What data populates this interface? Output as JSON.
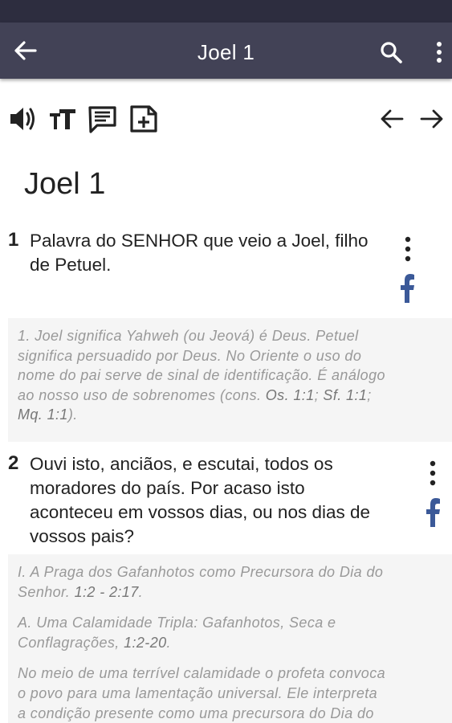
{
  "appbar": {
    "title": "Joel 1"
  },
  "chapter": {
    "title": "Joel 1"
  },
  "verses": [
    {
      "number": "1",
      "lines": [
        "Palavra do SENHOR que veio a Joel, filho",
        "de Petuel."
      ]
    },
    {
      "number": "2",
      "lines": [
        "Ouvi isto, anciãos, e escutai, todos os",
        "moradores do país. Por acaso isto",
        "aconteceu em vossos dias, ou nos dias de",
        "vossos pais?"
      ]
    }
  ],
  "notes": {
    "n1": {
      "lines": [
        "1. Joel significa Yahweh (ou Jeová) é Deus. Petuel",
        "significa persuadido por Deus. No Oriente o uso do",
        "nome do pai serve de sinal de identificação. É análogo",
        "ao nosso uso de sobrenomes (cons. "
      ],
      "ref_os": "Os. 1:1",
      "sep1": "; ",
      "ref_sf": "Sf. 1:1",
      "sep2": ";",
      "ref_mq": "Mq. 1:1",
      "end": ")."
    },
    "n2": {
      "heading1_line1": "I. A Praga dos Gafanhotos como Precursora do Dia do",
      "heading1_line2": "Senhor. ",
      "heading1_ref": "1:2 - 2:17",
      "heading1_end": ".",
      "heading2_line1": "A. Uma Calamidade Tripla: Gafanhotos, Seca e",
      "heading2_line2": "Conflagrações, ",
      "heading2_ref": "1:2-20",
      "heading2_end": ".",
      "body_lines": [
        "No meio de uma terrível calamidade o profeta convoca",
        "o povo para uma lamentação universal. Ele interpreta",
        "a condição presente como uma precursora do Dia do"
      ]
    }
  },
  "icons": {
    "back": "arrow-left-icon",
    "search": "search-icon",
    "more": "more-vertical-icon",
    "audio": "volume-icon",
    "text_size": "text-size-icon",
    "comment": "comment-icon",
    "add_note": "add-note-icon",
    "prev": "arrow-left-icon",
    "next": "arrow-right-icon",
    "facebook": "facebook-icon"
  },
  "colors": {
    "appbar": "#424256",
    "statusbar": "#2d2d3f",
    "facebook": "#3b5998",
    "note_bg": "#f5f5f5",
    "note_text": "#999999"
  }
}
